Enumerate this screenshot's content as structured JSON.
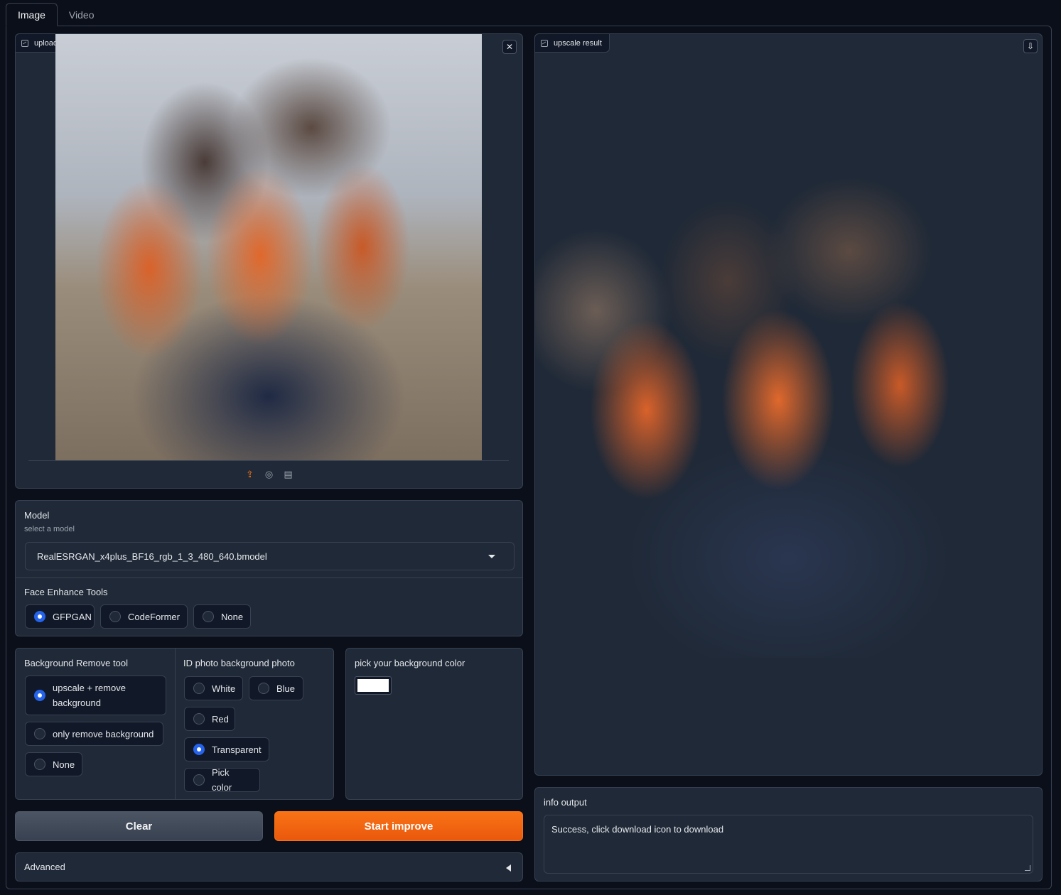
{
  "tabs": [
    {
      "label": "Image",
      "active": true
    },
    {
      "label": "Video",
      "active": false
    }
  ],
  "input_image": {
    "label": "upload a image to upscale resolution",
    "clear_icon": "close-icon",
    "sources": [
      "upload-icon",
      "webcam-icon",
      "clipboard-icon"
    ]
  },
  "output_image": {
    "label": "upscale result",
    "download_icon": "download-icon"
  },
  "model": {
    "label": "Model",
    "sublabel": "select a model",
    "selected": "RealESRGAN_x4plus_BF16_rgb_1_3_480_640.bmodel"
  },
  "face_enhance": {
    "label": "Face Enhance Tools",
    "options": [
      "GFPGAN",
      "CodeFormer",
      "None"
    ],
    "selected": "GFPGAN"
  },
  "bg_remove": {
    "label": "Background Remove tool",
    "options": [
      "upscale + remove background",
      "only remove background",
      "None"
    ],
    "selected": "upscale + remove background"
  },
  "id_photo": {
    "label": "ID photo background photo",
    "options": [
      "White",
      "Blue",
      "Red",
      "Transparent",
      "Pick color"
    ],
    "selected": "Transparent"
  },
  "color_picker": {
    "label": "pick your background color",
    "value": "#ffffff"
  },
  "buttons": {
    "clear": "Clear",
    "start": "Start improve"
  },
  "advanced": {
    "label": "Advanced"
  },
  "info": {
    "label": "info output",
    "value": "Success, click download icon to download"
  },
  "colors": {
    "accent": "#f97316",
    "radio_checked": "#2563eb",
    "panel": "#1f2937",
    "background": "#0b0f19"
  }
}
